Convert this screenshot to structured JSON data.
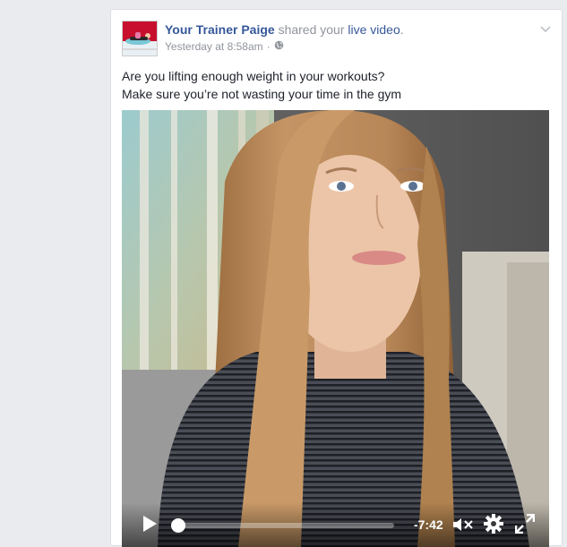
{
  "post": {
    "author": "Your Trainer Paige",
    "action_text": "shared your",
    "object_link": "live video",
    "period": ".",
    "timestamp": "Yesterday at 8:58am",
    "separator": "·",
    "audience_icon": "globe-icon",
    "menu_icon": "chevron-down-icon",
    "text_line_1": "Are you lifting enough weight in your workouts?",
    "text_line_2": "Make sure you’re not wasting your time in the gym"
  },
  "video": {
    "remaining_time": "-7:42",
    "progress": 0.02,
    "muted": true,
    "icons": [
      "play-icon",
      "mute-icon",
      "settings-gear-icon",
      "fullscreen-icon"
    ]
  },
  "colors": {
    "page_bg": "#e9ebee",
    "link": "#365899",
    "meta": "#90949c",
    "text": "#1d2129",
    "avatar_bg": "#c8102e"
  }
}
